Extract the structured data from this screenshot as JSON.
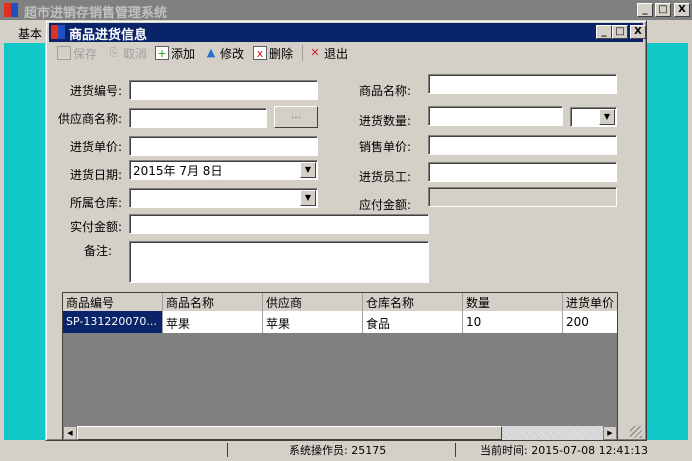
{
  "main_window": {
    "title": "超市进销存销售管理系统",
    "menu": [
      "基本"
    ]
  },
  "child_window": {
    "title": "商品进货信息"
  },
  "toolbar": {
    "save": "保存",
    "cancel": "取消",
    "add": "添加",
    "edit": "修改",
    "delete": "删除",
    "exit": "退出"
  },
  "form": {
    "purchase_no": "进货编号:",
    "product_name": "商品名称:",
    "supplier_name": "供应商名称:",
    "browse": "...",
    "quantity": "进货数量:",
    "purchase_price": "进货单价:",
    "sale_price": "销售单价:",
    "purchase_date": "进货日期:",
    "purchase_date_value": "2015年  7月  8日",
    "staff": "进货员工:",
    "warehouse": "所属仓库:",
    "payable": "应付金额:",
    "paid": "实付金额:",
    "remark": "备注:"
  },
  "grid": {
    "columns": [
      "商品编号",
      "商品名称",
      "供应商",
      "仓库名称",
      "数量",
      "进货单价"
    ],
    "rows": [
      [
        "SP-131220070...",
        "苹果",
        "苹果",
        "食品",
        "10",
        "200"
      ]
    ]
  },
  "statusbar": {
    "operator": "系统操作员: 25175",
    "time": "当前时间: 2015-07-08 12:41:13"
  }
}
